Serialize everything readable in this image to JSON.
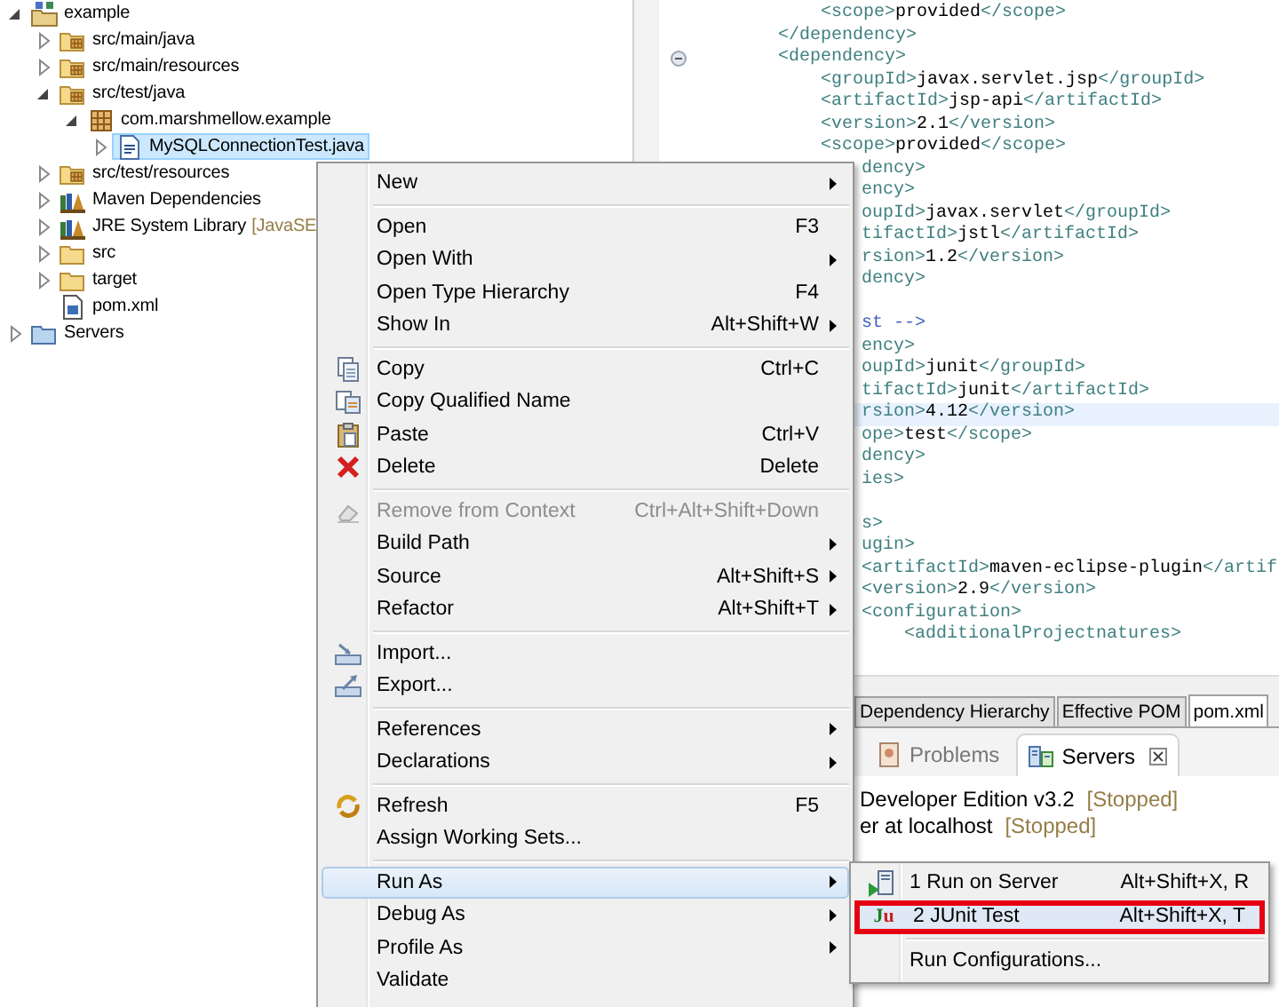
{
  "project_explorer": {
    "tree": [
      {
        "label": "example",
        "kind": "project",
        "expanded": true,
        "selected": false,
        "children": [
          {
            "label": "src/main/java",
            "kind": "source-folder",
            "expanded": false,
            "selected": false
          },
          {
            "label": "src/main/resources",
            "kind": "source-folder",
            "expanded": false,
            "selected": false
          },
          {
            "label": "src/test/java",
            "kind": "source-folder",
            "expanded": true,
            "selected": false,
            "children": [
              {
                "label": "com.marshmellow.example",
                "kind": "package",
                "expanded": true,
                "selected": false,
                "children": [
                  {
                    "label": "MySQLConnectionTest.java",
                    "kind": "java-file",
                    "expanded": false,
                    "selected": true
                  }
                ]
              }
            ]
          },
          {
            "label": "src/test/resources",
            "kind": "source-folder",
            "expanded": false,
            "selected": false
          },
          {
            "label": "Maven Dependencies",
            "kind": "library",
            "expanded": false,
            "selected": false
          },
          {
            "label": "JRE System Library",
            "decoration": "[JavaSE",
            "kind": "library",
            "expanded": false,
            "selected": false
          },
          {
            "label": "src",
            "kind": "folder",
            "expanded": false,
            "selected": false
          },
          {
            "label": "target",
            "kind": "folder",
            "expanded": false,
            "selected": false
          },
          {
            "label": "pom.xml",
            "kind": "xml-file",
            "selected": false
          }
        ]
      },
      {
        "label": "Servers",
        "kind": "server-folder",
        "expanded": false,
        "selected": false
      }
    ]
  },
  "editor": {
    "lines": [
      {
        "text": "            <scope>provided</scope>",
        "kind": "xml",
        "current": false,
        "fold_marker": false
      },
      {
        "text": "        </dependency>",
        "kind": "xml",
        "current": false,
        "fold_marker": false
      },
      {
        "text": "        <dependency>",
        "kind": "xml",
        "current": false,
        "fold_marker": true
      },
      {
        "text": "            <groupId>javax.servlet.jsp</groupId>",
        "kind": "xml",
        "current": false,
        "fold_marker": false
      },
      {
        "text": "            <artifactId>jsp-api</artifactId>",
        "kind": "xml",
        "current": false,
        "fold_marker": false
      },
      {
        "text": "            <version>2.1</version>",
        "kind": "xml",
        "current": false,
        "fold_marker": false
      },
      {
        "text": "            <scope>provided</scope>",
        "kind": "xml",
        "current": false,
        "fold_marker": false
      }
    ],
    "fragments": [
      {
        "text": "dency>",
        "kind": "xml",
        "current": false,
        "fold_marker": false
      },
      {
        "text": "ency>",
        "kind": "xml",
        "current": false,
        "fold_marker": false
      },
      {
        "text": "oupId>javax.servlet</groupId>",
        "kind": "xml",
        "current": false,
        "fold_marker": false
      },
      {
        "text": "tifactId>jstl</artifactId>",
        "kind": "xml",
        "current": false,
        "fold_marker": false
      },
      {
        "text": "rsion>1.2</version>",
        "kind": "xml",
        "current": false,
        "fold_marker": false
      },
      {
        "text": "dency>",
        "kind": "xml",
        "current": false,
        "fold_marker": false
      },
      {
        "kind": "blank"
      },
      {
        "text": "st -->",
        "kind": "comment",
        "current": false,
        "fold_marker": false
      },
      {
        "text": "ency>",
        "kind": "xml",
        "current": false,
        "fold_marker": false
      },
      {
        "text": "oupId>junit</groupId>",
        "kind": "xml",
        "current": false,
        "fold_marker": false
      },
      {
        "text": "tifactId>junit</artifactId>",
        "kind": "xml",
        "current": false,
        "fold_marker": false
      },
      {
        "text": "rsion>4.12</version>",
        "kind": "xml",
        "current": true,
        "fold_marker": false
      },
      {
        "text": "ope>test</scope>",
        "kind": "xml",
        "current": false,
        "fold_marker": false
      },
      {
        "text": "dency>",
        "kind": "xml",
        "current": false,
        "fold_marker": false
      },
      {
        "text": "ies>",
        "kind": "xml",
        "current": false,
        "fold_marker": false
      },
      {
        "kind": "blank"
      },
      {
        "text": "s>",
        "kind": "xml",
        "current": false,
        "fold_marker": false
      },
      {
        "text": "ugin>",
        "kind": "xml",
        "current": false,
        "fold_marker": false
      },
      {
        "text": "<artifactId>maven-eclipse-plugin</artif",
        "kind": "xml",
        "current": false,
        "fold_marker": false
      },
      {
        "text": "<version>2.9</version>",
        "kind": "xml",
        "current": false,
        "fold_marker": false
      },
      {
        "text": "<configuration>",
        "kind": "xml",
        "current": false,
        "fold_marker": false
      },
      {
        "text": "    <additionalProjectnatures>",
        "kind": "xml",
        "current": false,
        "fold_marker": false
      }
    ]
  },
  "pom_editor_tabs": [
    {
      "label": "Dependency Hierarchy",
      "selected": false
    },
    {
      "label": "Effective POM",
      "selected": false
    },
    {
      "label": "pom.xml",
      "selected": true
    }
  ],
  "view_tabs": [
    {
      "label": "Problems",
      "selected": false,
      "closable": false
    },
    {
      "label": "Servers",
      "selected": true,
      "closable": true
    }
  ],
  "servers": [
    {
      "name": "Developer Edition v3.2",
      "status": "[Stopped]"
    },
    {
      "name": "er at localhost",
      "status": "[Stopped]"
    }
  ],
  "context_menu": {
    "groups": [
      [
        {
          "label": "New",
          "submenu": true,
          "disabled": false,
          "selected": false
        }
      ],
      [
        {
          "label": "Open",
          "shortcut": "F3",
          "submenu": false,
          "disabled": false,
          "selected": false
        },
        {
          "label": "Open With",
          "submenu": true,
          "disabled": false,
          "selected": false
        },
        {
          "label": "Open Type Hierarchy",
          "shortcut": "F4",
          "submenu": false,
          "disabled": false,
          "selected": false
        },
        {
          "label": "Show In",
          "shortcut": "Alt+Shift+W",
          "submenu": true,
          "disabled": false,
          "selected": false
        }
      ],
      [
        {
          "label": "Copy",
          "shortcut": "Ctrl+C",
          "submenu": false,
          "disabled": false,
          "selected": false
        },
        {
          "label": "Copy Qualified Name",
          "submenu": false,
          "disabled": false,
          "selected": false
        },
        {
          "label": "Paste",
          "shortcut": "Ctrl+V",
          "submenu": false,
          "disabled": false,
          "selected": false
        },
        {
          "label": "Delete",
          "shortcut": "Delete",
          "submenu": false,
          "disabled": false,
          "selected": false
        }
      ],
      [
        {
          "label": "Remove from Context",
          "shortcut": "Ctrl+Alt+Shift+Down",
          "submenu": false,
          "disabled": true,
          "selected": false
        },
        {
          "label": "Build Path",
          "submenu": true,
          "disabled": false,
          "selected": false
        },
        {
          "label": "Source",
          "shortcut": "Alt+Shift+S",
          "submenu": true,
          "disabled": false,
          "selected": false
        },
        {
          "label": "Refactor",
          "shortcut": "Alt+Shift+T",
          "submenu": true,
          "disabled": false,
          "selected": false
        }
      ],
      [
        {
          "label": "Import...",
          "submenu": false,
          "disabled": false,
          "selected": false
        },
        {
          "label": "Export...",
          "submenu": false,
          "disabled": false,
          "selected": false
        }
      ],
      [
        {
          "label": "References",
          "submenu": true,
          "disabled": false,
          "selected": false
        },
        {
          "label": "Declarations",
          "submenu": true,
          "disabled": false,
          "selected": false
        }
      ],
      [
        {
          "label": "Refresh",
          "shortcut": "F5",
          "submenu": false,
          "disabled": false,
          "selected": false
        },
        {
          "label": "Assign Working Sets...",
          "submenu": false,
          "disabled": false,
          "selected": false
        }
      ],
      [
        {
          "label": "Run As",
          "submenu": true,
          "disabled": false,
          "selected": true
        },
        {
          "label": "Debug As",
          "submenu": true,
          "disabled": false,
          "selected": false
        },
        {
          "label": "Profile As",
          "submenu": true,
          "disabled": false,
          "selected": false
        },
        {
          "label": "Validate",
          "submenu": false,
          "disabled": false,
          "selected": false
        }
      ]
    ],
    "submenu": {
      "groups": [
        [
          {
            "label": "1 Run on Server",
            "shortcut": "Alt+Shift+X, R",
            "selected": false
          },
          {
            "label": "2 JUnit Test",
            "shortcut": "Alt+Shift+X, T",
            "icon_text": "Ju",
            "selected": true
          }
        ],
        [
          {
            "label": "Run Configurations...",
            "selected": false
          }
        ]
      ]
    }
  }
}
